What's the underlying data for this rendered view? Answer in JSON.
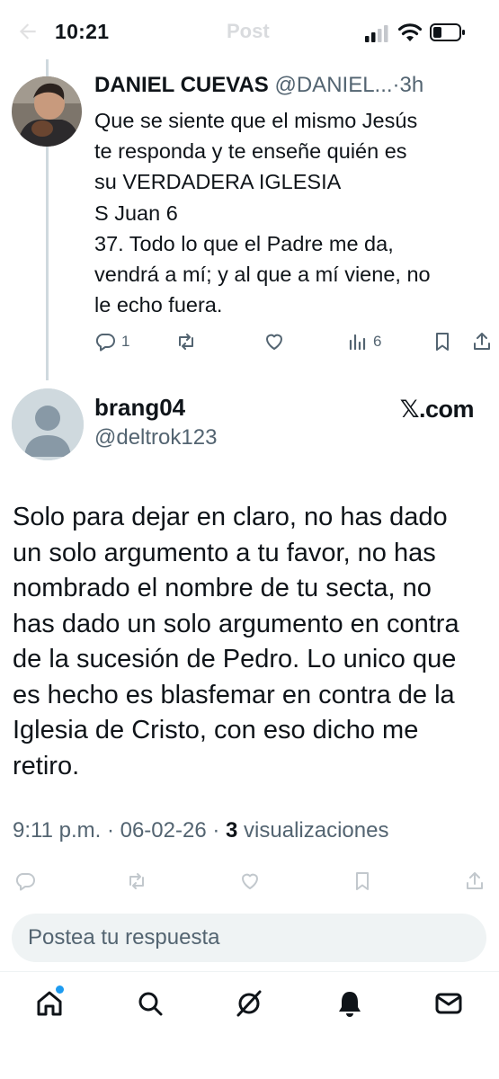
{
  "status_bar": {
    "time": "10:21",
    "header_title": "Post"
  },
  "parent_tweet": {
    "author_name": "DANIEL CUEVAS",
    "handle": "@DANIEL...",
    "separator": "·",
    "age": "3h",
    "lines": [
      "Que se siente que el mismo Jesús",
      "te responda y te enseñe quién es",
      "su VERDADERA IGLESIA",
      "S Juan 6",
      "37. Todo lo que el Padre me da,",
      "vendrá a mí; y al que a mí viene, no",
      "le echo fuera."
    ],
    "reply_count": "1",
    "view_count": "6"
  },
  "quoted_post": {
    "author_name": "brang04",
    "handle": "@deltrok123",
    "brand": "𝕏.com",
    "lines": [
      "Solo para dejar en claro, no has dado",
      "un solo argumento a tu favor, no has",
      "nombrado el nombre de tu secta, no",
      "has dado un solo argumento en contra",
      "de la sucesión de Pedro. Lo unico que",
      "es hecho es blasfemar en contra de la",
      "Iglesia de Cristo, con eso dicho me",
      "retiro."
    ],
    "time": "9:11 p.m.",
    "date": "06-02-26",
    "views_number": "3",
    "views_label": "visualizaciones"
  },
  "reply": {
    "placeholder": "Postea tu respuesta"
  },
  "icons": {
    "nav": [
      "home-icon",
      "search-icon",
      "grok-icon",
      "notifications-icon",
      "messages-icon"
    ],
    "actions": [
      "reply-icon",
      "repost-icon",
      "like-icon",
      "views-icon",
      "bookmark-icon",
      "share-icon"
    ]
  },
  "colors": {
    "text": "#0f1419",
    "secondary": "#536471",
    "accent": "#1d9bf0",
    "input_bg": "#eff3f4"
  }
}
